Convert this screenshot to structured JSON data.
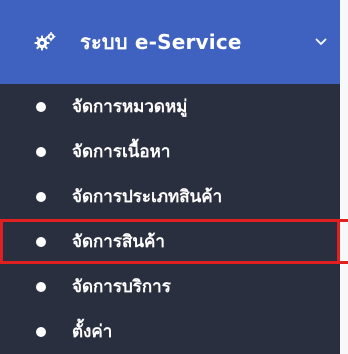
{
  "menu": {
    "header": {
      "icon": "gears-icon",
      "title": "ระบบ e-Service",
      "chevron_icon": "chevron-down-icon"
    },
    "items": [
      {
        "label": "จัดการหมวดหมู่",
        "highlighted": false
      },
      {
        "label": "จัดการเนื้อหา",
        "highlighted": false
      },
      {
        "label": "จัดการประเภทสินค้า",
        "highlighted": false
      },
      {
        "label": "จัดการสินค้า",
        "highlighted": true
      },
      {
        "label": "จัดการบริการ",
        "highlighted": false
      },
      {
        "label": "ตั้งค่า",
        "highlighted": false
      }
    ]
  },
  "colors": {
    "sidebar_bg": "#2a2f3f",
    "header_bg": "#3f62c0",
    "highlight_border": "#e02020",
    "text": "#ffffff"
  }
}
